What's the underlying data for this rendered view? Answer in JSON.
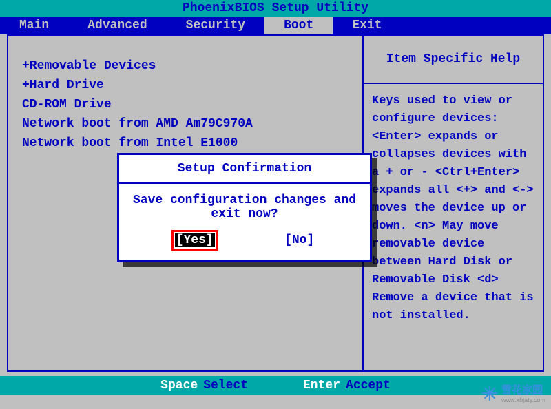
{
  "title": "PhoenixBIOS Setup Utility",
  "menu": {
    "items": [
      "Main",
      "Advanced",
      "Security",
      "Boot",
      "Exit"
    ],
    "active_index": 3
  },
  "boot_list": [
    "+Removable Devices",
    "+Hard Drive",
    " CD-ROM Drive",
    " Network boot from AMD Am79C970A",
    " Network boot from Intel E1000"
  ],
  "help": {
    "title": "Item Specific Help",
    "text": "Keys used to view or configure devices:\n<Enter> expands or collapses devices with a + or -\n<Ctrl+Enter> expands all\n<+> and <-> moves the device up or down.\n<n> May move removable device between Hard Disk or Removable Disk\n<d> Remove a device that is not installed."
  },
  "footer": {
    "key1": "Space",
    "label1": "Select",
    "key2": "Enter",
    "label2": "Accept"
  },
  "dialog": {
    "title": "Setup Confirmation",
    "message": "Save configuration changes and exit now?",
    "yes": "[Yes]",
    "no": "[No]"
  },
  "watermark": {
    "text": "雪花家园",
    "url": "www.xhjaty.com"
  }
}
